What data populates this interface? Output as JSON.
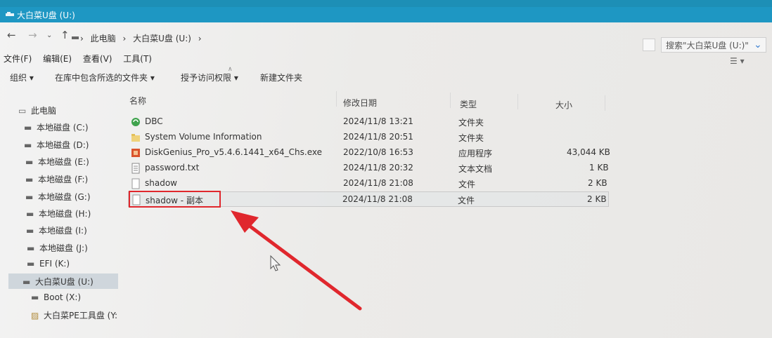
{
  "window": {
    "title": "大白菜U盘 (U:)"
  },
  "address": {
    "breadcrumb": [
      "此电脑",
      "大白菜U盘 (U:)"
    ],
    "search_placeholder": "搜索\"大白菜U盘 (U:)\""
  },
  "menu": [
    "文件(F)",
    "编辑(E)",
    "查看(V)",
    "工具(T)"
  ],
  "commands": {
    "organize": "组织",
    "include_library": "在库中包含所选的文件夹",
    "grant_access": "授予访问权限",
    "new_folder": "新建文件夹"
  },
  "nav": {
    "items": [
      {
        "label": "此电脑",
        "icon": "pc-icon"
      },
      {
        "label": "本地磁盘 (C:)",
        "icon": "drive-icon"
      },
      {
        "label": "本地磁盘 (D:)",
        "icon": "drive-icon"
      },
      {
        "label": "本地磁盘 (E:)",
        "icon": "drive-icon"
      },
      {
        "label": "本地磁盘 (F:)",
        "icon": "drive-icon"
      },
      {
        "label": "本地磁盘 (G:)",
        "icon": "drive-icon"
      },
      {
        "label": "本地磁盘 (H:)",
        "icon": "drive-icon"
      },
      {
        "label": "本地磁盘 (I:)",
        "icon": "drive-icon"
      },
      {
        "label": "本地磁盘 (J:)",
        "icon": "drive-icon"
      },
      {
        "label": "EFI (K:)",
        "icon": "drive-icon"
      },
      {
        "label": "大白菜U盘 (U:)",
        "icon": "usb-drive-icon",
        "selected": true
      },
      {
        "label": "Boot (X:)",
        "icon": "drive-icon"
      },
      {
        "label": "大白菜PE工具盘 (Y:",
        "icon": "tool-drive-icon"
      }
    ]
  },
  "columns": {
    "name": "名称",
    "modified": "修改日期",
    "type": "类型",
    "size": "大小"
  },
  "files": [
    {
      "name": "DBC",
      "modified": "2024/11/8 13:21",
      "type": "文件夹",
      "size": "",
      "icon": "folder-sync-icon"
    },
    {
      "name": "System Volume Information",
      "modified": "2024/11/8 20:51",
      "type": "文件夹",
      "size": "",
      "icon": "folder-icon"
    },
    {
      "name": "DiskGenius_Pro_v5.4.6.1441_x64_Chs.exe",
      "modified": "2022/10/8 16:53",
      "type": "应用程序",
      "size": "43,044 KB",
      "icon": "exe-icon"
    },
    {
      "name": "password.txt",
      "modified": "2024/11/8 20:32",
      "type": "文本文档",
      "size": "1 KB",
      "icon": "text-file-icon"
    },
    {
      "name": "shadow",
      "modified": "2024/11/8 21:08",
      "type": "文件",
      "size": "2 KB",
      "icon": "file-icon"
    },
    {
      "name": "shadow - 副本",
      "modified": "2024/11/8 21:08",
      "type": "文件",
      "size": "2 KB",
      "icon": "file-icon",
      "selected": true
    }
  ],
  "colors": {
    "titlebar": "#1e97c3",
    "annotation": "#e0272d"
  }
}
